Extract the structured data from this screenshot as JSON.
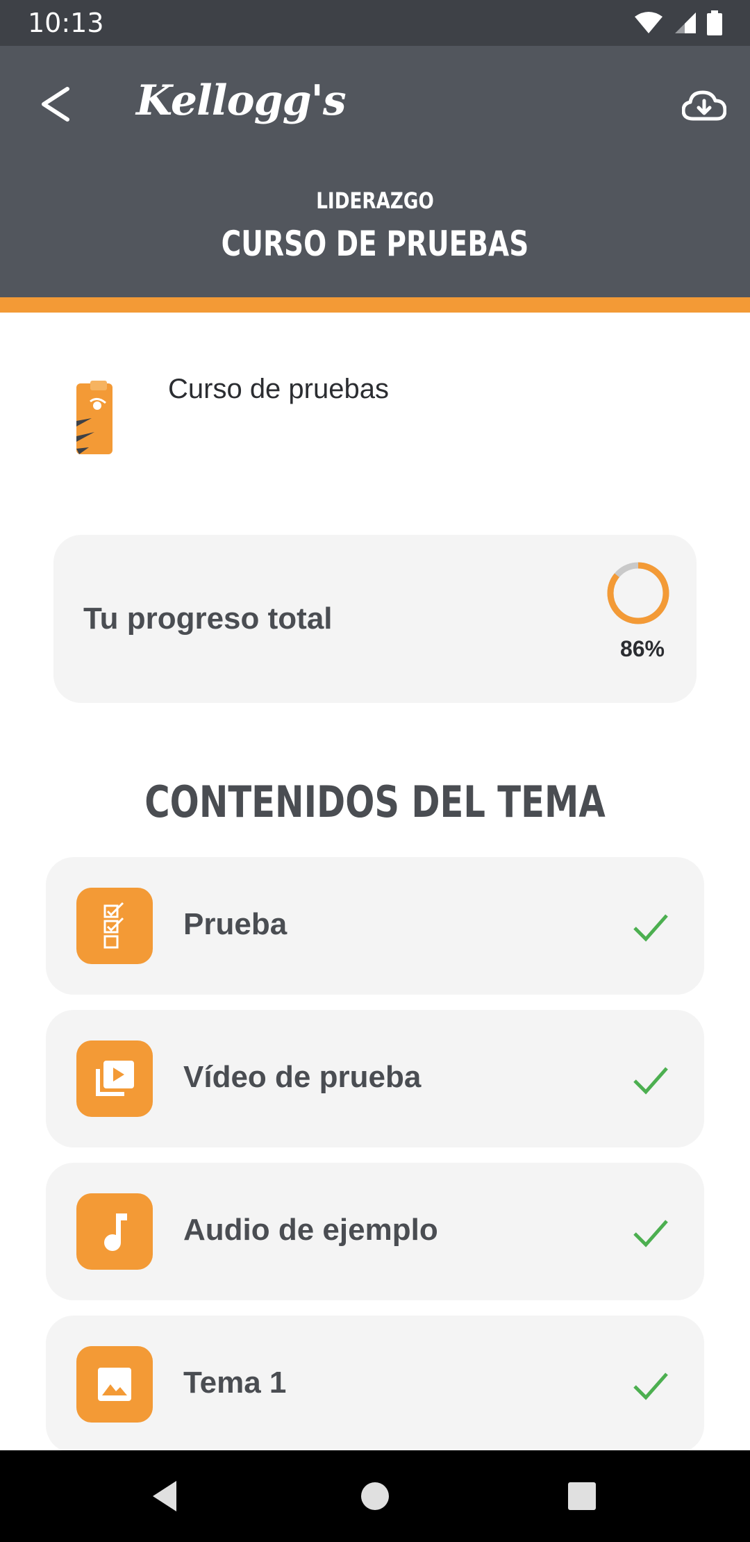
{
  "status_bar": {
    "time": "10:13"
  },
  "header": {
    "brand": "Kellogg's",
    "category": "LIDERAZGO",
    "title": "CURSO DE PRUEBAS",
    "colors": {
      "background": "#52565d",
      "accent": "#f39a36"
    }
  },
  "course": {
    "name": "Curso de pruebas"
  },
  "progress": {
    "label": "Tu progreso total",
    "value_text": "86%",
    "fraction": 0.86
  },
  "contents": {
    "title": "CONTENIDOS DEL TEMA",
    "items": [
      {
        "label": "Prueba",
        "icon": "checklist-icon",
        "completed": true
      },
      {
        "label": "Vídeo de prueba",
        "icon": "video-library-icon",
        "completed": true
      },
      {
        "label": "Audio de ejemplo",
        "icon": "music-note-icon",
        "completed": true
      },
      {
        "label": "Tema 1",
        "icon": "image-icon",
        "completed": true
      }
    ]
  }
}
